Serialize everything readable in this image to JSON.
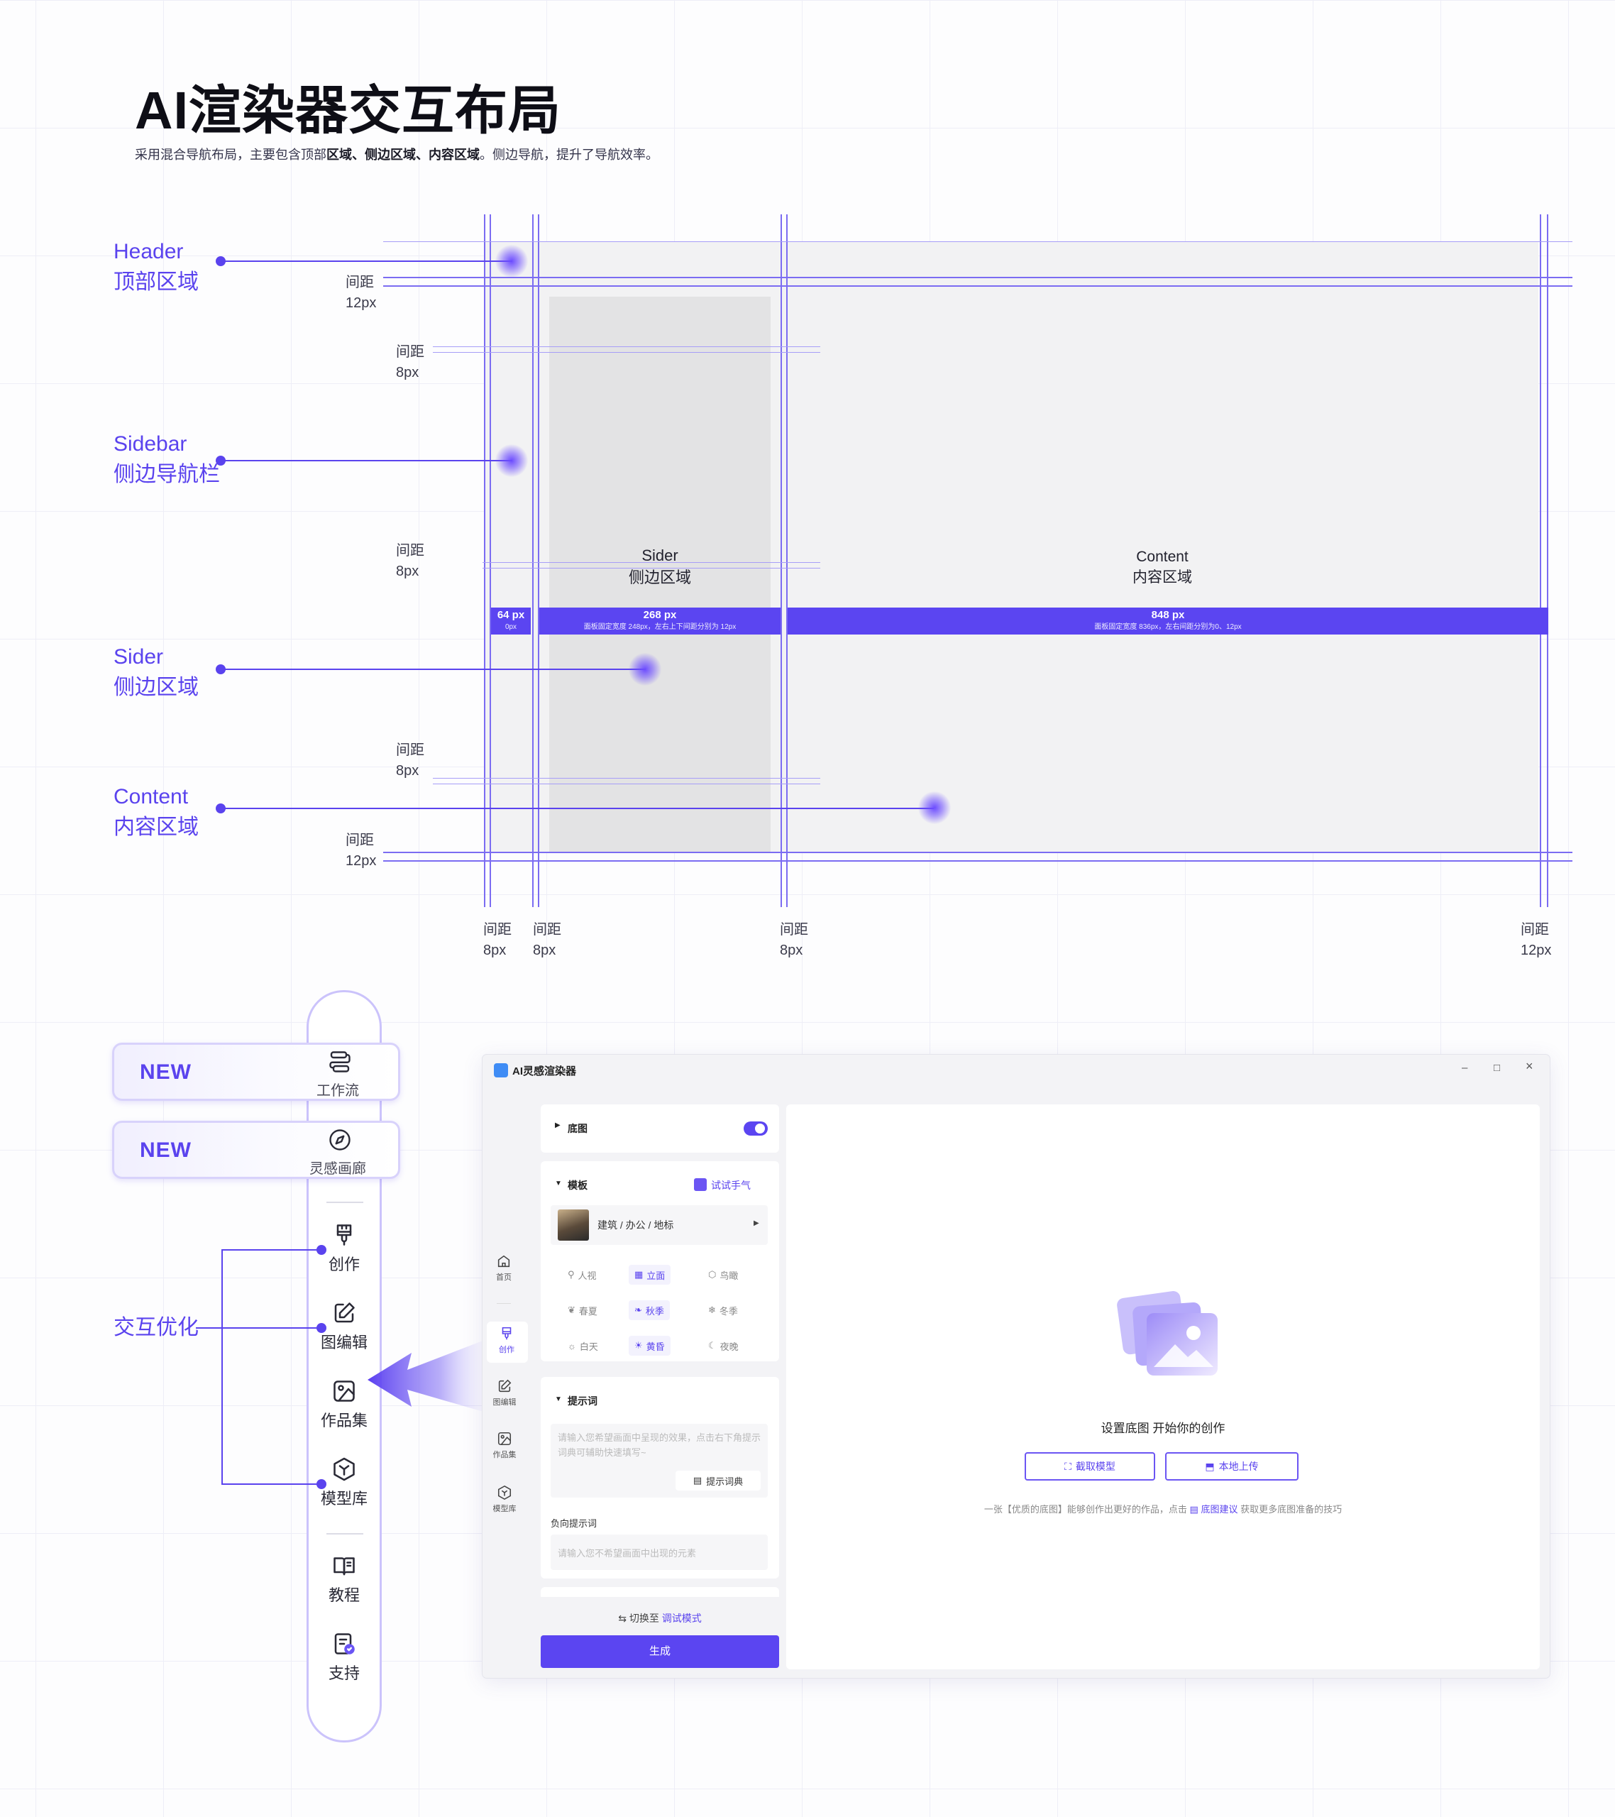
{
  "header": {
    "title": "AI渲染器交互布局",
    "subtitle_pre": "采用混合导航布局，主要包含顶部",
    "subtitle_b1": "区域、侧边区域、内容区域",
    "subtitle_post": "。侧边导航，提升了导航效率。"
  },
  "annotations": {
    "header_en": "Header",
    "header_zh": "顶部区域",
    "sidebar_en": "Sidebar",
    "sidebar_zh": "侧边导航栏",
    "sider_en": "Sider",
    "sider_zh": "侧边区域",
    "content_en": "Content",
    "content_zh": "内容区域"
  },
  "gaps": {
    "label": "间距",
    "g12": "12px",
    "g8": "8px"
  },
  "zones": {
    "sider_en": "Sider",
    "sider_zh": "侧边区域",
    "content_en": "Content",
    "content_zh": "内容区域"
  },
  "measure": {
    "nav_w": "64 px",
    "nav_note": "0px",
    "sider_w": "268 px",
    "sider_note": "面板固定宽度 248px，左右上下间距分别为 12px",
    "content_w": "848 px",
    "content_note": "面板固定宽度 836px，左右间距分别为0、12px"
  },
  "nav": {
    "new_badge": "NEW",
    "workflow": "工作流",
    "gallery": "灵感画廊",
    "create": "创作",
    "edit": "图编辑",
    "works": "作品集",
    "models": "模型库",
    "tutorial": "教程",
    "support": "支持",
    "opt_label": "交互优化"
  },
  "app": {
    "title": "AI灵感渲染器",
    "ctrl_min": "–",
    "ctrl_max": "□",
    "ctrl_close": "×",
    "nav": [
      "首页",
      "创作",
      "图编辑",
      "作品集",
      "模型库"
    ],
    "base": "底图",
    "template": "模板",
    "try": "试试手气",
    "template_sel": "建筑 / 办公 / 地标",
    "chips": [
      [
        "人视",
        "立面",
        "鸟瞰"
      ],
      [
        "春夏",
        "秋季",
        "冬季"
      ],
      [
        "白天",
        "黄昏",
        "夜晚"
      ]
    ],
    "prompt": "提示词",
    "prompt_ph": "请输入您希望画面中呈现的效果，点击右下角提示词典可辅助快速填写~",
    "dict": "提示词典",
    "neg": "负向提示词",
    "neg_ph": "请输入您不希望画面中出现的元素",
    "switch_pre": "切换至",
    "switch_mode": "调试模式",
    "generate": "生成",
    "empty_title": "设置底图 开始你的创作",
    "btn_capture": "截取模型",
    "btn_upload": "本地上传",
    "tip_pre": "一张【优质的底图】能够创作出更好的作品，点击",
    "tip_link": "底图建议",
    "tip_post": "获取更多底图准备的技巧"
  },
  "colors": {
    "accent": "#5a43ee",
    "bar": "#5b45f1"
  }
}
